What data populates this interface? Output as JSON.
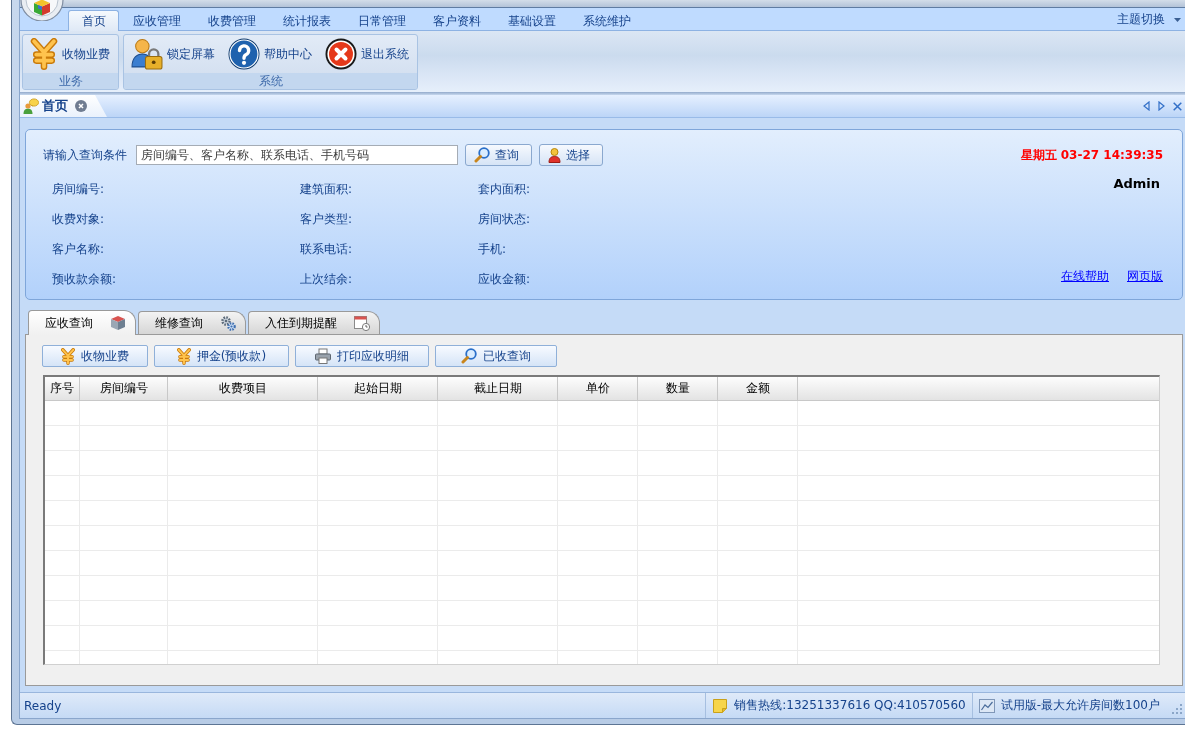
{
  "ribbon": {
    "tabs": [
      {
        "label": "首页",
        "selected": true
      },
      {
        "label": "应收管理",
        "selected": false
      },
      {
        "label": "收费管理",
        "selected": false
      },
      {
        "label": "统计报表",
        "selected": false
      },
      {
        "label": "日常管理",
        "selected": false
      },
      {
        "label": "客户资料",
        "selected": false
      },
      {
        "label": "基础设置",
        "selected": false
      },
      {
        "label": "系统维护",
        "selected": false
      }
    ],
    "theme_switch": "主题切换",
    "groups": [
      {
        "label": "业务",
        "buttons": [
          "收物业费"
        ]
      },
      {
        "label": "系统",
        "buttons": [
          "锁定屏幕",
          "帮助中心",
          "退出系统"
        ]
      }
    ]
  },
  "document_tabs": [
    {
      "label": "首页",
      "selected": true
    }
  ],
  "query_panel": {
    "prompt": "请输入查询条件",
    "search": {
      "placeholder": "房间编号、客户名称、联系电话、手机号码"
    },
    "buttons": [
      "查询",
      "选择"
    ],
    "datetime": "星期五 03-27 14:39:35",
    "user": "Admin",
    "info_labels": [
      "房间编号:",
      "建筑面积:",
      "套内面积:",
      "收费对象:",
      "客户类型:",
      "房间状态:",
      "客户名称:",
      "联系电话:",
      "手机:",
      "预收款余额:",
      "上次结余:",
      "应收金额:"
    ],
    "links": [
      "在线帮助",
      "网页版"
    ]
  },
  "content_tabs": [
    {
      "label": "应收查询",
      "selected": true
    },
    {
      "label": "维修查询",
      "selected": false
    },
    {
      "label": "入住到期提醒",
      "selected": false
    }
  ],
  "toolbar": [
    "收物业费",
    "押金(预收款)",
    "打印应收明细",
    "已收查询"
  ],
  "table": {
    "columns": [
      "序号",
      "房间编号",
      "收费项目",
      "起始日期",
      "截止日期",
      "单价",
      "数量",
      "金额"
    ]
  },
  "status_bar": {
    "status": "Ready",
    "hotline": "销售热线:13251337616 QQ:410570560",
    "license": "试用版-最大允许房间数100户"
  }
}
